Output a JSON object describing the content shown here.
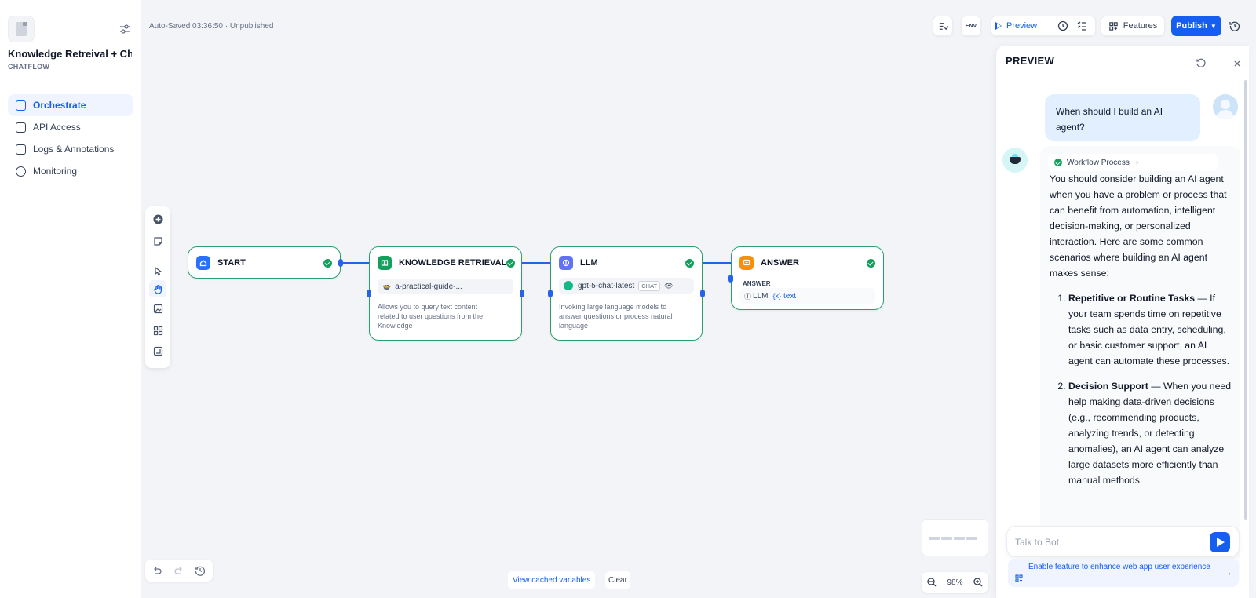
{
  "app": {
    "name": "Knowledge Retreival + Ch...",
    "type": "CHATFLOW",
    "autosave": "Auto-Saved 03:36:50 · Unpublished"
  },
  "sidebar": {
    "items": [
      {
        "label": "Orchestrate",
        "icon": "layout-icon",
        "active": true
      },
      {
        "label": "API Access",
        "icon": "terminal-icon",
        "active": false
      },
      {
        "label": "Logs & Annotations",
        "icon": "file-list-icon",
        "active": false
      },
      {
        "label": "Monitoring",
        "icon": "dashboard-icon",
        "active": false
      }
    ]
  },
  "toolbar": {
    "env_label": "ENV",
    "preview_label": "Preview",
    "features_label": "Features",
    "publish_label": "Publish",
    "accent": "#155eef"
  },
  "nodes": {
    "start": {
      "title": "START",
      "icon": "home-icon",
      "color": "#2970ff"
    },
    "knowledge": {
      "title": "KNOWLEDGE RETRIEVAL",
      "icon": "book-icon",
      "color": "#12a05c",
      "dataset": "a-practical-guide-...",
      "desc": [
        "Allows you to query text content",
        "related to user questions from the",
        "Knowledge"
      ]
    },
    "llm": {
      "title": "LLM",
      "icon": "brain-icon",
      "color": "#6172f3",
      "model": "gpt-5-chat-latest",
      "mode": "CHAT",
      "desc": [
        "Invoking large language models to",
        "answer questions or process natural",
        "language"
      ]
    },
    "answer": {
      "title": "ANSWER",
      "icon": "message-icon",
      "color": "#f79009",
      "field_label": "ANSWER",
      "ref_node": "LLM",
      "ref_var": "text"
    }
  },
  "canvas": {
    "cache_label": "View cached variables",
    "clear_label": "Clear",
    "zoom": "98%"
  },
  "preview": {
    "title": "PREVIEW",
    "user_message": "When should I build an AI agent?",
    "workflow_label": "Workflow Process",
    "answer_intro": "You should consider building an AI agent when you have a problem or process that can benefit from automation, intelligent decision-making, or personalized interaction. Here are some common scenarios where building an AI agent makes sense:",
    "answer_items": [
      {
        "title": "Repetitive or Routine Tasks",
        "text": " — If your team spends time on repetitive tasks such as data entry, scheduling, or basic customer support, an AI agent can automate these processes."
      },
      {
        "title": "Decision Support",
        "text": " — When you need help making data-driven decisions (e.g., recommending products, analyzing trends, or detecting anomalies), an AI agent can analyze large datasets more efficiently than manual methods."
      }
    ],
    "input_placeholder": "Talk to Bot",
    "feature_text": "Enable feature to enhance web app user experience"
  }
}
